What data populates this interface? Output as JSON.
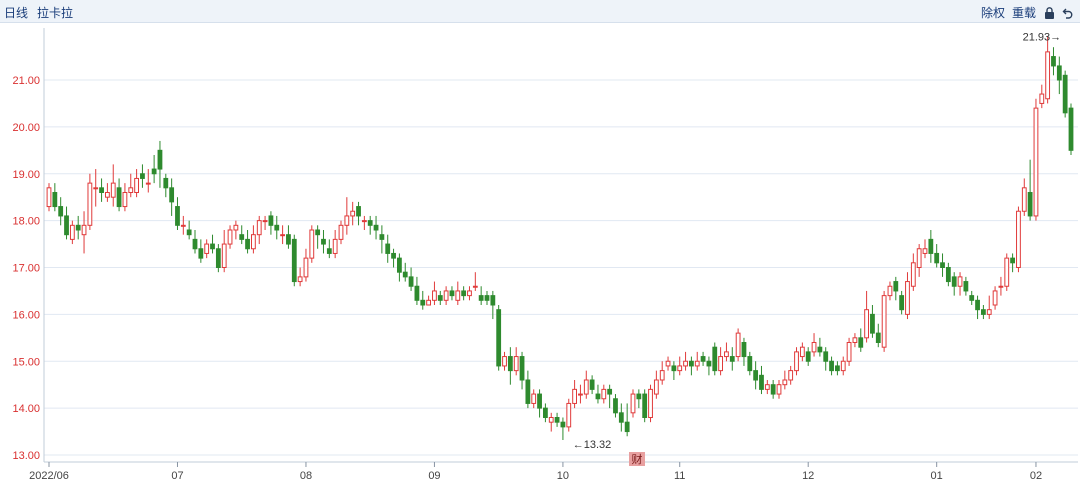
{
  "toolbar": {
    "period_label": "日线",
    "indicator_label": "拉卡拉",
    "adjust_label": "除权",
    "overlay_label": "重载",
    "lock_icon": "lock-icon",
    "back_icon": "undo-icon"
  },
  "badge": {
    "label": "财"
  },
  "colors": {
    "up": "#e03a3a",
    "down": "#2e8a2e",
    "grid": "#e1e8f2",
    "axis": "#c2cdd9",
    "label_red": "#d93030"
  },
  "chart_data": {
    "type": "candlestick",
    "y_ticks": [
      "13.00",
      "14.00",
      "15.00",
      "16.00",
      "17.00",
      "18.00",
      "19.00",
      "20.00",
      "21.00"
    ],
    "ylim": [
      12.9,
      22.0
    ],
    "x_labels": [
      "2022/06",
      "07",
      "08",
      "09",
      "10",
      "11",
      "12",
      "01",
      "02"
    ],
    "x_label_index": [
      0,
      22,
      44,
      66,
      88,
      108,
      130,
      152,
      169
    ],
    "max_label": "21.93→",
    "min_label": "←13.32",
    "max_value": 21.93,
    "min_value": 13.32,
    "max_index": 174,
    "min_index": 89,
    "candles": [
      [
        18.3,
        18.7,
        18.8,
        18.2
      ],
      [
        18.6,
        18.3,
        18.8,
        18.2
      ],
      [
        18.3,
        18.1,
        18.5,
        17.9
      ],
      [
        18.1,
        17.7,
        18.3,
        17.6
      ],
      [
        17.6,
        17.9,
        18.0,
        17.5
      ],
      [
        17.9,
        17.8,
        18.1,
        17.6
      ],
      [
        17.7,
        17.9,
        18.2,
        17.3
      ],
      [
        17.9,
        18.8,
        19.0,
        17.8
      ],
      [
        18.7,
        18.7,
        19.1,
        18.3
      ],
      [
        18.7,
        18.6,
        18.9,
        18.4
      ],
      [
        18.5,
        18.6,
        18.8,
        18.4
      ],
      [
        18.5,
        18.8,
        19.2,
        18.3
      ],
      [
        18.7,
        18.3,
        18.9,
        18.2
      ],
      [
        18.3,
        18.6,
        18.8,
        18.2
      ],
      [
        18.6,
        18.7,
        19.0,
        18.5
      ],
      [
        18.6,
        18.9,
        19.1,
        18.5
      ],
      [
        19.0,
        18.9,
        19.2,
        18.7
      ],
      [
        18.8,
        18.8,
        19.1,
        18.6
      ],
      [
        19.1,
        19.0,
        19.4,
        18.8
      ],
      [
        19.5,
        19.1,
        19.7,
        18.7
      ],
      [
        18.9,
        18.7,
        19.0,
        18.5
      ],
      [
        18.7,
        18.4,
        18.9,
        18.1
      ],
      [
        18.3,
        17.9,
        18.5,
        17.8
      ],
      [
        17.9,
        17.9,
        18.1,
        17.7
      ],
      [
        17.8,
        17.7,
        18.0,
        17.6
      ],
      [
        17.6,
        17.4,
        17.8,
        17.3
      ],
      [
        17.4,
        17.2,
        17.6,
        17.1
      ],
      [
        17.3,
        17.5,
        17.6,
        17.2
      ],
      [
        17.5,
        17.4,
        17.7,
        17.3
      ],
      [
        17.4,
        17.0,
        17.5,
        16.9
      ],
      [
        17.0,
        17.5,
        17.8,
        16.9
      ],
      [
        17.5,
        17.8,
        17.9,
        17.4
      ],
      [
        17.8,
        17.9,
        18.0,
        17.6
      ],
      [
        17.7,
        17.6,
        17.9,
        17.5
      ],
      [
        17.6,
        17.4,
        17.8,
        17.3
      ],
      [
        17.4,
        17.7,
        17.9,
        17.3
      ],
      [
        17.7,
        18.0,
        18.1,
        17.5
      ],
      [
        18.0,
        18.0,
        18.1,
        17.8
      ],
      [
        18.1,
        17.9,
        18.2,
        17.7
      ],
      [
        17.9,
        17.8,
        18.1,
        17.6
      ],
      [
        17.7,
        17.7,
        17.9,
        17.5
      ],
      [
        17.7,
        17.5,
        17.9,
        17.4
      ],
      [
        17.6,
        16.7,
        17.7,
        16.6
      ],
      [
        16.7,
        16.8,
        17.0,
        16.6
      ],
      [
        16.8,
        17.2,
        17.4,
        16.7
      ],
      [
        17.2,
        17.8,
        17.9,
        17.1
      ],
      [
        17.8,
        17.7,
        17.9,
        17.4
      ],
      [
        17.6,
        17.5,
        17.8,
        17.3
      ],
      [
        17.4,
        17.3,
        17.6,
        17.2
      ],
      [
        17.3,
        17.6,
        17.8,
        17.2
      ],
      [
        17.6,
        17.9,
        18.0,
        17.5
      ],
      [
        17.9,
        18.1,
        18.5,
        17.7
      ],
      [
        18.1,
        18.2,
        18.4,
        17.9
      ],
      [
        18.3,
        18.1,
        18.4,
        17.9
      ],
      [
        18.0,
        18.0,
        18.1,
        17.8
      ],
      [
        18.0,
        17.9,
        18.1,
        17.7
      ],
      [
        17.9,
        17.8,
        18.1,
        17.6
      ],
      [
        17.7,
        17.6,
        17.9,
        17.3
      ],
      [
        17.5,
        17.3,
        17.7,
        17.1
      ],
      [
        17.3,
        17.2,
        17.4,
        17.0
      ],
      [
        17.2,
        16.9,
        17.3,
        16.7
      ],
      [
        16.9,
        16.8,
        17.1,
        16.7
      ],
      [
        16.8,
        16.6,
        17.0,
        16.5
      ],
      [
        16.6,
        16.3,
        16.8,
        16.2
      ],
      [
        16.3,
        16.2,
        16.5,
        16.1
      ],
      [
        16.2,
        16.3,
        16.4,
        16.2
      ],
      [
        16.3,
        16.5,
        16.7,
        16.2
      ],
      [
        16.4,
        16.3,
        16.5,
        16.2
      ],
      [
        16.3,
        16.5,
        16.6,
        16.2
      ],
      [
        16.5,
        16.4,
        16.6,
        16.3
      ],
      [
        16.3,
        16.5,
        16.7,
        16.2
      ],
      [
        16.5,
        16.4,
        16.6,
        16.3
      ],
      [
        16.4,
        16.5,
        16.6,
        16.3
      ],
      [
        16.6,
        16.6,
        16.9,
        16.5
      ],
      [
        16.4,
        16.3,
        16.6,
        16.2
      ],
      [
        16.4,
        16.3,
        16.5,
        16.2
      ],
      [
        16.4,
        16.2,
        16.5,
        15.9
      ],
      [
        16.1,
        14.9,
        16.2,
        14.8
      ],
      [
        14.9,
        15.1,
        15.2,
        14.8
      ],
      [
        15.1,
        14.8,
        15.3,
        14.5
      ],
      [
        14.8,
        15.1,
        15.3,
        14.7
      ],
      [
        15.1,
        14.6,
        15.2,
        14.4
      ],
      [
        14.6,
        14.1,
        14.8,
        14.0
      ],
      [
        14.1,
        14.3,
        14.4,
        14.0
      ],
      [
        14.3,
        14.0,
        14.4,
        13.8
      ],
      [
        14.0,
        13.8,
        14.1,
        13.7
      ],
      [
        13.7,
        13.8,
        13.9,
        13.5
      ],
      [
        13.8,
        13.7,
        13.9,
        13.6
      ],
      [
        13.7,
        13.6,
        13.8,
        13.32
      ],
      [
        13.6,
        14.1,
        14.2,
        13.5
      ],
      [
        14.1,
        14.4,
        14.6,
        14.0
      ],
      [
        14.3,
        14.3,
        14.5,
        14.1
      ],
      [
        14.3,
        14.6,
        14.8,
        14.2
      ],
      [
        14.6,
        14.4,
        14.7,
        14.3
      ],
      [
        14.3,
        14.2,
        14.5,
        14.1
      ],
      [
        14.2,
        14.4,
        14.5,
        14.1
      ],
      [
        14.4,
        14.3,
        14.5,
        14.0
      ],
      [
        14.2,
        13.9,
        14.3,
        13.8
      ],
      [
        13.9,
        13.7,
        14.1,
        13.5
      ],
      [
        13.7,
        13.5,
        14.1,
        13.4
      ],
      [
        13.9,
        14.3,
        14.4,
        13.8
      ],
      [
        14.3,
        14.2,
        14.4,
        14.0
      ],
      [
        14.3,
        13.8,
        14.4,
        13.7
      ],
      [
        13.8,
        14.4,
        14.5,
        13.7
      ],
      [
        14.3,
        14.6,
        14.8,
        14.2
      ],
      [
        14.6,
        14.8,
        15.0,
        14.5
      ],
      [
        14.9,
        15.0,
        15.1,
        14.8
      ],
      [
        14.9,
        14.8,
        15.0,
        14.6
      ],
      [
        14.8,
        14.9,
        15.1,
        14.7
      ],
      [
        14.9,
        15.0,
        15.2,
        14.8
      ],
      [
        15.0,
        14.9,
        15.1,
        14.7
      ],
      [
        14.9,
        15.0,
        15.2,
        14.8
      ],
      [
        15.1,
        15.0,
        15.2,
        14.9
      ],
      [
        15.0,
        14.9,
        15.1,
        14.7
      ],
      [
        15.3,
        14.8,
        15.4,
        14.7
      ],
      [
        14.8,
        15.1,
        15.3,
        14.7
      ],
      [
        15.1,
        15.2,
        15.4,
        15.0
      ],
      [
        15.1,
        15.0,
        15.3,
        14.8
      ],
      [
        15.1,
        15.6,
        15.7,
        15.0
      ],
      [
        15.4,
        15.1,
        15.5,
        14.9
      ],
      [
        15.1,
        14.8,
        15.2,
        14.7
      ],
      [
        14.8,
        14.6,
        15.0,
        14.4
      ],
      [
        14.7,
        14.4,
        14.9,
        14.3
      ],
      [
        14.4,
        14.5,
        14.6,
        14.3
      ],
      [
        14.5,
        14.3,
        14.6,
        14.2
      ],
      [
        14.3,
        14.5,
        14.6,
        14.2
      ],
      [
        14.5,
        14.6,
        14.8,
        14.4
      ],
      [
        14.6,
        14.8,
        14.9,
        14.5
      ],
      [
        14.8,
        15.2,
        15.3,
        14.7
      ],
      [
        15.1,
        15.3,
        15.4,
        15.0
      ],
      [
        15.2,
        15.0,
        15.3,
        14.9
      ],
      [
        15.2,
        15.4,
        15.6,
        15.1
      ],
      [
        15.3,
        15.2,
        15.5,
        15.1
      ],
      [
        15.2,
        15.0,
        15.3,
        14.8
      ],
      [
        15.0,
        14.8,
        15.1,
        14.7
      ],
      [
        14.9,
        14.8,
        15.0,
        14.7
      ],
      [
        14.8,
        15.0,
        15.1,
        14.7
      ],
      [
        15.0,
        15.4,
        15.5,
        14.9
      ],
      [
        15.4,
        15.5,
        15.6,
        15.3
      ],
      [
        15.5,
        15.3,
        15.7,
        15.2
      ],
      [
        15.5,
        16.1,
        16.5,
        15.4
      ],
      [
        16.0,
        15.6,
        16.2,
        15.5
      ],
      [
        15.6,
        15.4,
        15.8,
        15.3
      ],
      [
        15.3,
        16.4,
        16.5,
        15.2
      ],
      [
        16.4,
        16.6,
        16.7,
        16.3
      ],
      [
        16.7,
        16.5,
        16.8,
        16.3
      ],
      [
        16.4,
        16.1,
        16.5,
        16.0
      ],
      [
        16.0,
        16.7,
        16.9,
        15.9
      ],
      [
        16.6,
        17.1,
        17.3,
        16.5
      ],
      [
        17.0,
        17.4,
        17.5,
        16.8
      ],
      [
        17.3,
        17.4,
        17.6,
        17.2
      ],
      [
        17.6,
        17.3,
        17.8,
        17.1
      ],
      [
        17.3,
        17.1,
        17.5,
        17.0
      ],
      [
        17.1,
        17.0,
        17.3,
        16.8
      ],
      [
        17.0,
        16.7,
        17.1,
        16.6
      ],
      [
        16.8,
        16.6,
        16.9,
        16.4
      ],
      [
        16.6,
        16.8,
        16.9,
        16.4
      ],
      [
        16.7,
        16.5,
        16.8,
        16.4
      ],
      [
        16.4,
        16.3,
        16.5,
        16.2
      ],
      [
        16.3,
        16.1,
        16.4,
        15.9
      ],
      [
        16.1,
        16.0,
        16.2,
        15.9
      ],
      [
        16.0,
        16.1,
        16.4,
        15.9
      ],
      [
        16.2,
        16.5,
        16.6,
        16.1
      ],
      [
        16.6,
        16.6,
        16.8,
        16.4
      ],
      [
        16.6,
        17.2,
        17.3,
        16.5
      ],
      [
        17.2,
        17.1,
        17.3,
        16.9
      ],
      [
        17.0,
        18.2,
        18.3,
        16.9
      ],
      [
        18.2,
        18.7,
        18.9,
        18.1
      ],
      [
        18.6,
        18.1,
        19.3,
        18.0
      ],
      [
        18.1,
        20.4,
        20.6,
        18.0
      ],
      [
        20.5,
        20.7,
        20.9,
        20.4
      ],
      [
        20.6,
        21.6,
        21.93,
        20.5
      ],
      [
        21.5,
        21.3,
        21.7,
        21.1
      ],
      [
        21.3,
        21.0,
        21.5,
        20.7
      ],
      [
        21.1,
        20.3,
        21.2,
        20.2
      ],
      [
        20.4,
        19.5,
        20.5,
        19.4
      ]
    ]
  }
}
